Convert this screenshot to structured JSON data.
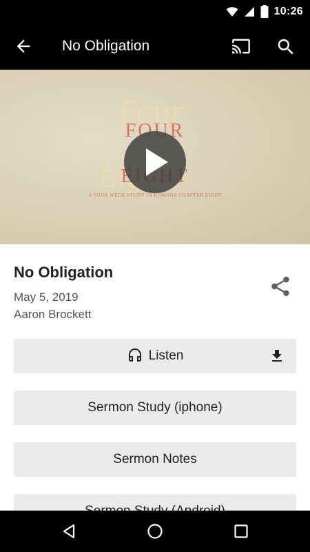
{
  "status_bar": {
    "time": "10:26"
  },
  "app_bar": {
    "title": "No Obligation"
  },
  "video": {
    "artwork_title_line1": "FOUR",
    "artwork_title_line2": "EIGHT",
    "artwork_script_line1": "Four",
    "artwork_script_line2": "Eight",
    "artwork_subtitle": "A FOUR WEEK STUDY IN ROMANS CHAPTER EIGHT"
  },
  "sermon": {
    "title": "No Obligation",
    "date": "May 5, 2019",
    "speaker": "Aaron Brockett"
  },
  "actions": {
    "listen_label": "Listen",
    "study_iphone_label": "Sermon Study (iphone)",
    "notes_label": "Sermon Notes",
    "study_android_label": "Sermon Study (Android)"
  },
  "colors": {
    "bar_background": "#000000",
    "button_background": "#ebebeb",
    "artwork_accent": "#d4735e"
  }
}
